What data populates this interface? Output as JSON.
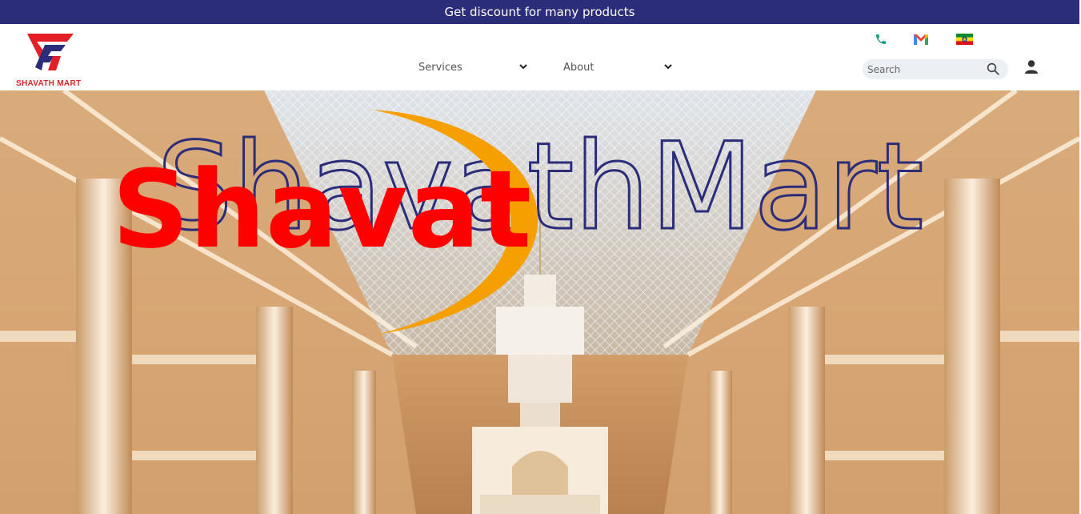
{
  "promo": {
    "text": "Get discount for many products"
  },
  "header": {
    "logo_text": "SHAVATH MART",
    "nav": [
      {
        "label": "Services"
      },
      {
        "label": "About"
      }
    ],
    "search": {
      "placeholder": "Search",
      "value": ""
    },
    "contact_icons": [
      "phone-icon",
      "gmail-icon",
      "ethiopia-flag-icon"
    ],
    "user_icon": "user-icon"
  },
  "hero": {
    "outline_text": "ShavathMart",
    "overlay_text": "Shavat"
  },
  "colors": {
    "promo_bg": "#2b2d7a",
    "brand_red": "#e41e26",
    "outline_navy": "#2b2d7a",
    "accent_orange": "#f5a000",
    "phone_green": "#16a085"
  }
}
